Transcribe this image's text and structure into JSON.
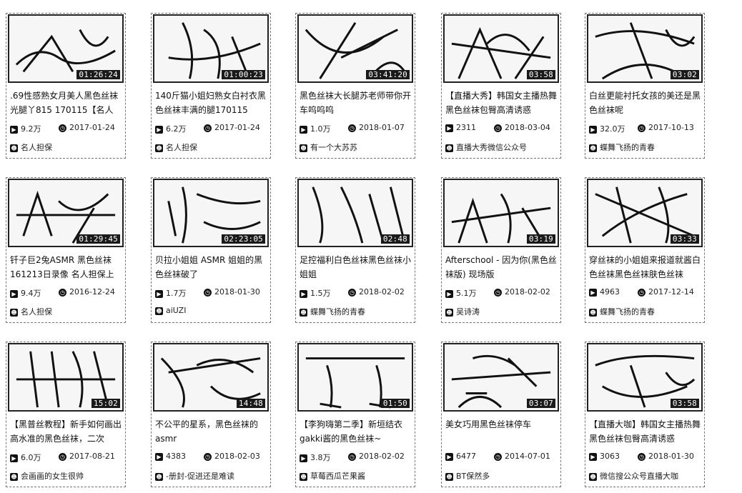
{
  "icons": {
    "plays": "play-count-icon",
    "date": "clock-icon",
    "author": "user-icon"
  },
  "videos": [
    {
      "title": ".69性感熟女月美人黑色丝袜光腿丫815 170115【名人",
      "duration": "01:26:24",
      "plays": "9.2万",
      "date": "2017-01-24",
      "author": "名人担保"
    },
    {
      "title": "140斤猫小姐妇熟女白衬衣黑色丝袜丰满的腿170115",
      "duration": "01:00:23",
      "plays": "6.2万",
      "date": "2017-01-24",
      "author": "名人担保"
    },
    {
      "title": "黑色丝袜大长腿苏老师带你开车呜呜呜",
      "duration": "03:41:20",
      "plays": "1.0万",
      "date": "2018-01-07",
      "author": "有一个大苏苏"
    },
    {
      "title": "【直播大秀】韩国女主播热舞黑色丝袜包臀高清诱惑",
      "duration": "03:58",
      "plays": "2311",
      "date": "2018-03-04",
      "author": "直播大秀微信公众号"
    },
    {
      "title": "白丝更能衬托女孩的美还是黑色丝袜呢",
      "duration": "03:02",
      "plays": "32.0万",
      "date": "2017-10-13",
      "author": "蝶舞飞扬的青春"
    },
    {
      "title": "钎子巨2兔ASMR 黑色丝袜161213日录像 名人担保上",
      "duration": "01:29:45",
      "plays": "9.4万",
      "date": "2016-12-24",
      "author": "名人担保"
    },
    {
      "title": "贝拉小姐姐 ASMR 姐姐的黑色丝袜破了",
      "duration": "02:23:05",
      "plays": "1.7万",
      "date": "2018-01-30",
      "author": "aiUZI"
    },
    {
      "title": "足控福利白色丝袜黑色丝袜小姐姐",
      "duration": "02:48",
      "plays": "1.5万",
      "date": "2018-02-02",
      "author": "蝶舞飞扬的青春"
    },
    {
      "title": "Afterschool - 因为你(黑色丝袜版) 现场版",
      "duration": "03:19",
      "plays": "5.1万",
      "date": "2018-02-02",
      "author": "吴诗涛"
    },
    {
      "title": "穿丝袜的小姐姐来报道就酱白色丝袜黑色丝袜肤色丝袜",
      "duration": "03:33",
      "plays": "4963",
      "date": "2017-12-14",
      "author": "蝶舞飞扬的青春"
    },
    {
      "title": "【黑普丝教程】新手如何画出高水准的黑色丝袜，二次",
      "duration": "15:02",
      "plays": "6.0万",
      "date": "2017-08-21",
      "author": "会画画的女生很帅"
    },
    {
      "title": "不公平的星系，黑色丝袜的asmr",
      "duration": "14:48",
      "plays": "4383",
      "date": "2018-02-03",
      "author": "-册封-促进还是难读"
    },
    {
      "title": "【李狗嗨第二季】新垣结衣gakki酱的黑色丝袜~",
      "duration": "01:50",
      "plays": "3.8万",
      "date": "2018-02-02",
      "author": "草莓西瓜芒果酱"
    },
    {
      "title": "美女巧用黑色丝袜停车",
      "duration": "03:07",
      "plays": "6477",
      "date": "2014-07-01",
      "author": "BT保然多"
    },
    {
      "title": "【直播大咖】韩国女主播热舞黑色丝袜包臀高清诱惑",
      "duration": "03:58",
      "plays": "3063",
      "date": "2018-01-30",
      "author": "微信搜公众号直播大咖"
    }
  ]
}
